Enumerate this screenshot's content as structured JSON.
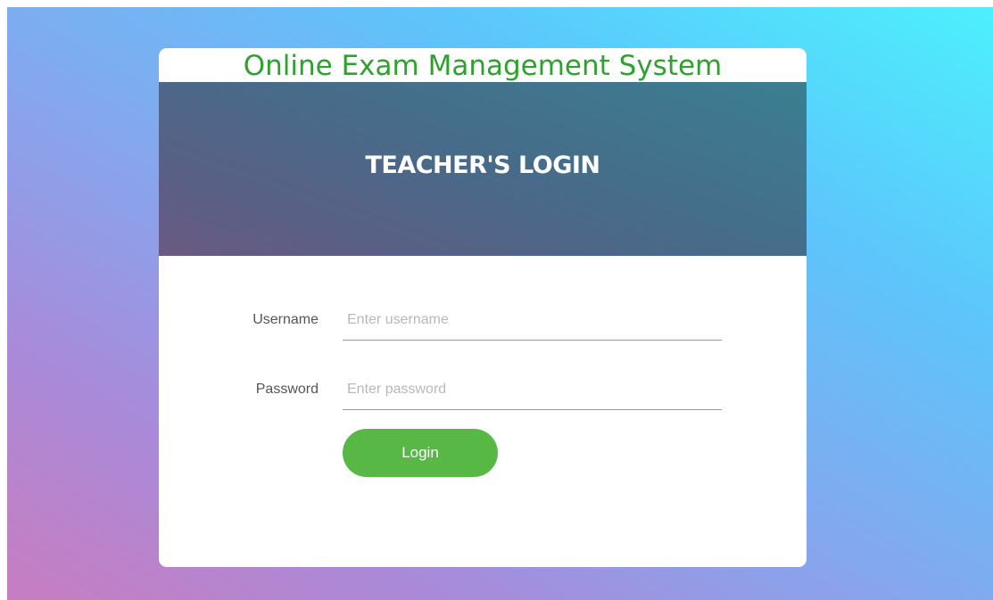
{
  "page": {
    "system_title": "Online Exam Management System",
    "login_heading": "TEACHER'S LOGIN"
  },
  "form": {
    "username": {
      "label": "Username",
      "placeholder": "Enter username",
      "value": ""
    },
    "password": {
      "label": "Password",
      "placeholder": "Enter password",
      "value": ""
    },
    "submit_label": "Login"
  },
  "colors": {
    "title_green": "#2ea12e",
    "button_green": "#57b846",
    "banner_teal": "#3b7f91",
    "background_gradient": [
      "#c87dc0",
      "#a98ad9",
      "#86a6ee",
      "#5dc5fb",
      "#4cf0fd"
    ]
  }
}
